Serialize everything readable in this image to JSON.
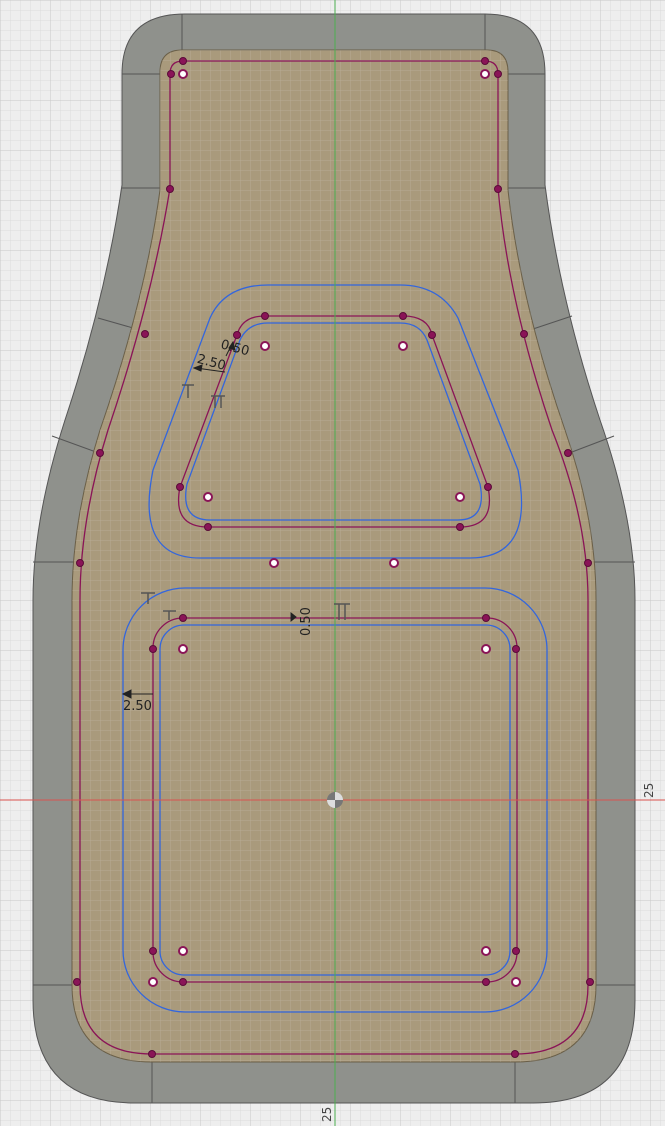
{
  "colors": {
    "background": "#eeeeee",
    "grid_minor": "#dcdcdc",
    "grid_major": "#c8c8c8",
    "axis_vertical": "#4caf50",
    "axis_horizontal": "#d9534f",
    "body_wall": "#8f918c",
    "body_wall_dark": "#6e706c",
    "face": "#a99a7c",
    "profile": "#8a1457",
    "offset": "#3366dd",
    "point_fill": "#8a1457",
    "open_point_fill": "#ffffff",
    "origin": "#666666"
  },
  "dimensions": {
    "upper_outer": "2.50",
    "upper_inner": "0.50",
    "lower_inner": "0.50",
    "lower_outer": "2.50"
  },
  "axes": {
    "horizontal_label": "25",
    "vertical_label": "25"
  },
  "icons": [
    "constraint-glyph-icon",
    "origin-icon"
  ]
}
